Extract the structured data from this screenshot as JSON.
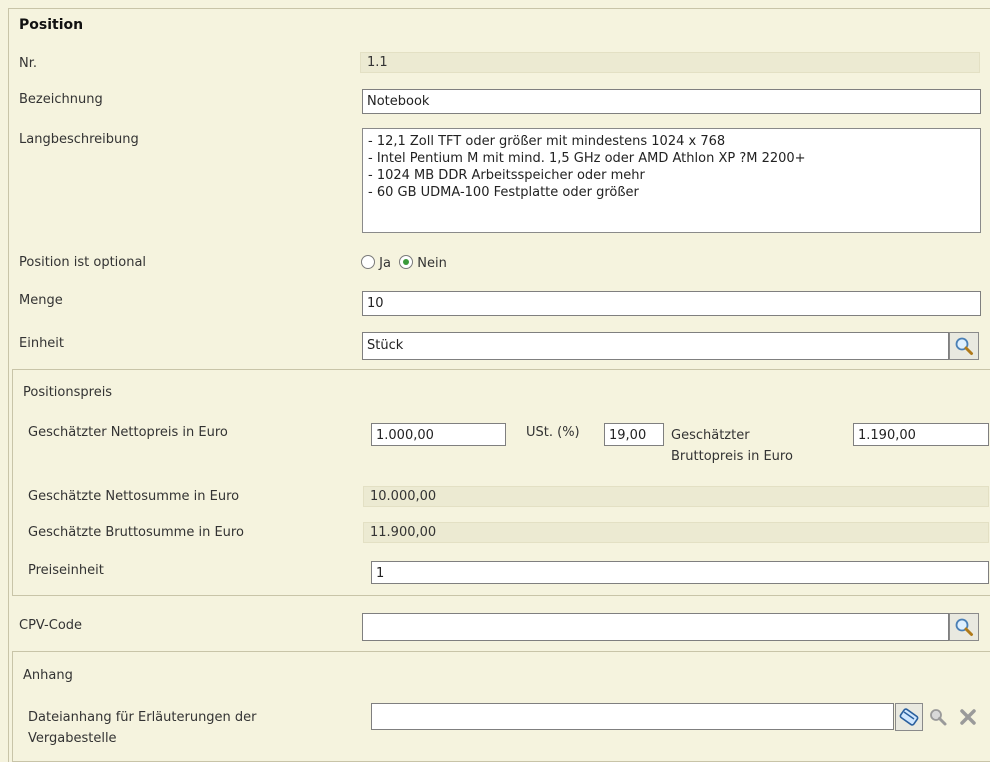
{
  "section_title": "Position",
  "fields": {
    "nr": {
      "label": "Nr.",
      "value": "1.1"
    },
    "bezeichnung": {
      "label": "Bezeichnung",
      "value": "Notebook"
    },
    "langbeschreibung": {
      "label": "Langbeschreibung",
      "lines": [
        "- 12,1 Zoll TFT oder größer mit mindestens 1024 x 768",
        "- Intel Pentium M mit mind. 1,5 GHz oder AMD Athlon XP ?M 2200+",
        "- 1024 MB DDR Arbeitsspeicher oder mehr",
        "- 60 GB UDMA-100 Festplatte oder größer"
      ]
    },
    "optional": {
      "label": "Position ist optional",
      "option_ja": "Ja",
      "option_nein": "Nein",
      "selected": "Nein"
    },
    "menge": {
      "label": "Menge",
      "value": "10"
    },
    "einheit": {
      "label": "Einheit",
      "value": "Stück"
    }
  },
  "positionspreis": {
    "title": "Positionspreis",
    "netto_label": "Geschätzter Nettopreis in Euro",
    "netto_value": "1.000,00",
    "ust_label": "USt. (%)",
    "ust_value": "19,00",
    "brutto_label_1": "Geschätzter",
    "brutto_label_2": "Bruttopreis in Euro",
    "brutto_value": "1.190,00",
    "nettosumme_label": "Geschätzte Nettosumme in Euro",
    "nettosumme_value": "10.000,00",
    "bruttosumme_label": "Geschätzte Bruttosumme in Euro",
    "bruttosumme_value": "11.900,00",
    "preiseinheit_label": "Preiseinheit",
    "preiseinheit_value": "1"
  },
  "cpv": {
    "label": "CPV-Code",
    "value": ""
  },
  "anhang": {
    "title": "Anhang",
    "label_1": "Dateianhang für Erläuterungen der",
    "label_2": "Vergabestelle",
    "value": ""
  },
  "icons": [
    "search-icon",
    "attach-icon",
    "view-icon",
    "delete-icon"
  ]
}
